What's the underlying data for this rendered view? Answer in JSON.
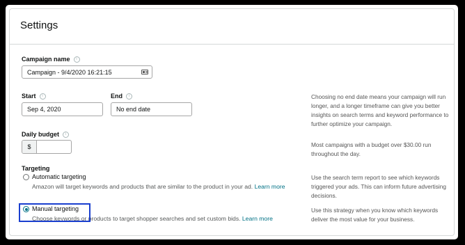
{
  "header": {
    "title": "Settings"
  },
  "campaign_name": {
    "label": "Campaign name",
    "value": "Campaign - 9/4/2020 16:21:15"
  },
  "start": {
    "label": "Start",
    "value": "Sep 4, 2020"
  },
  "end": {
    "label": "End",
    "value": "No end date"
  },
  "end_hint": "Choosing no end date means your campaign will run longer, and a longer timeframe can give you better insights on search terms and keyword performance to further optimize your campaign.",
  "daily_budget": {
    "label": "Daily budget",
    "currency": "$",
    "value": "",
    "hint": "Most campaigns with a budget over $30.00 run throughout the day."
  },
  "targeting": {
    "label": "Targeting",
    "options": [
      {
        "title": "Automatic targeting",
        "desc": "Amazon will target keywords and products that are similar to the product in your ad.",
        "link": "Learn more",
        "hint": "Use the search term report to see which keywords triggered your ads. This can inform future advertising decisions.",
        "selected": false
      },
      {
        "title": "Manual targeting",
        "desc": "Choose keywords or products to target shopper searches and set custom bids.",
        "link": "Learn more",
        "hint": "Use this strategy when you know which keywords deliver the most value for your business.",
        "selected": true
      }
    ]
  },
  "colors": {
    "link": "#007185",
    "highlight_box": "#1a3fcf",
    "border": "#d5d9d9"
  }
}
